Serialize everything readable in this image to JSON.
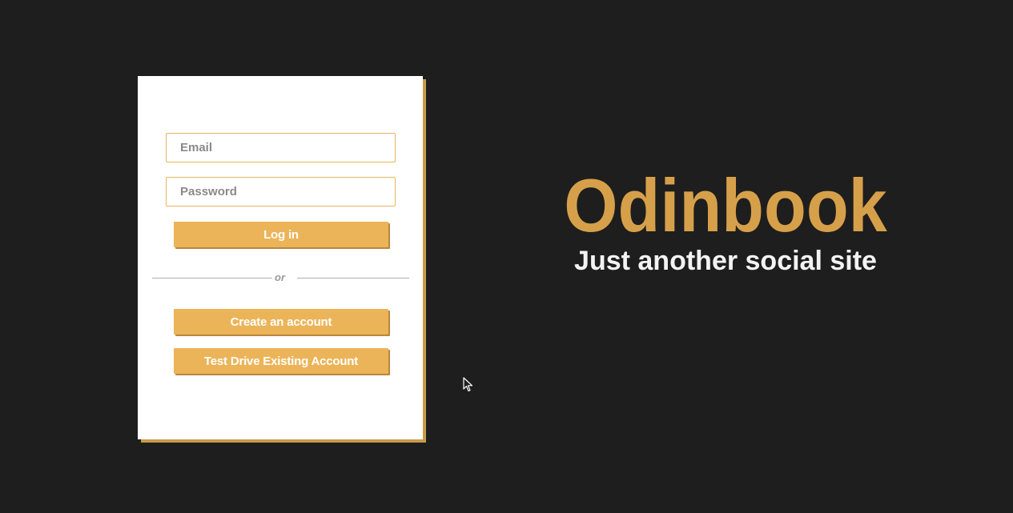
{
  "login_form": {
    "email_placeholder": "Email",
    "password_placeholder": "Password",
    "login_label": "Log in",
    "divider_text": "or",
    "create_account_label": "Create an account",
    "test_drive_label": "Test Drive Existing Account"
  },
  "brand": {
    "title": "Odinbook",
    "tagline": "Just another social site"
  },
  "colors": {
    "background": "#1e1e1e",
    "accent": "#ecb458",
    "brand_title": "#d6a04a",
    "card": "#ffffff"
  },
  "icons": {
    "pointer": "mouse-pointer-icon"
  }
}
